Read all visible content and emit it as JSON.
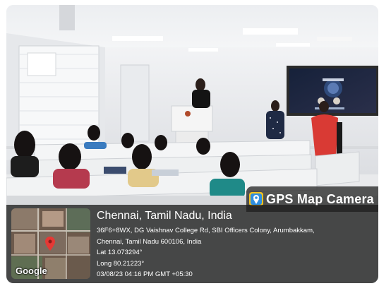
{
  "watermark": {
    "title": "GPS Map Camera",
    "icon": "gps-map-camera-icon"
  },
  "location": {
    "place": "Chennai, Tamil Nadu, India",
    "address_line1": "36F6+8WX, DG Vaishnav College Rd, SBI Officers Colony, Arumbakkam,",
    "address_line2": "Chennai, Tamil Nadu 600106, India",
    "latitude": "Lat 13.073294°",
    "longitude": "Long 80.21223°",
    "datetime": "03/08/23 04:16 PM GMT +05:30"
  },
  "map": {
    "attribution": "Google",
    "pin": "location-pin-icon"
  },
  "colors": {
    "overlay": "#262626",
    "pin": "#e53935",
    "presenter_saree": "#d93a34"
  }
}
